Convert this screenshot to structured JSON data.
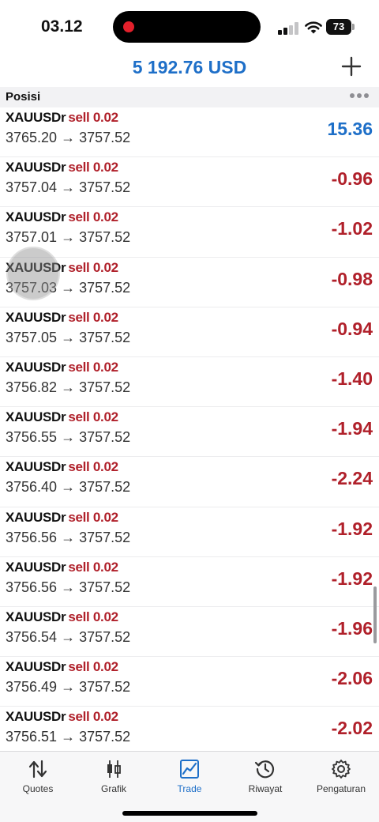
{
  "status": {
    "time": "03.12",
    "battery": "73"
  },
  "header": {
    "balance": "5 192.76 USD"
  },
  "section": {
    "title": "Posisi"
  },
  "positions": [
    {
      "symbol": "XAUUSDr",
      "side": "sell 0.02",
      "prices": "3765.20 → 3757.52",
      "profit": "15.36",
      "sign": "pos"
    },
    {
      "symbol": "XAUUSDr",
      "side": "sell 0.02",
      "prices": "3757.04 → 3757.52",
      "profit": "-0.96",
      "sign": "neg"
    },
    {
      "symbol": "XAUUSDr",
      "side": "sell 0.02",
      "prices": "3757.01 → 3757.52",
      "profit": "-1.02",
      "sign": "neg"
    },
    {
      "symbol": "XAUUSDr",
      "side": "sell 0.02",
      "prices": "3757.03 → 3757.52",
      "profit": "-0.98",
      "sign": "neg"
    },
    {
      "symbol": "XAUUSDr",
      "side": "sell 0.02",
      "prices": "3757.05 → 3757.52",
      "profit": "-0.94",
      "sign": "neg"
    },
    {
      "symbol": "XAUUSDr",
      "side": "sell 0.02",
      "prices": "3756.82 → 3757.52",
      "profit": "-1.40",
      "sign": "neg"
    },
    {
      "symbol": "XAUUSDr",
      "side": "sell 0.02",
      "prices": "3756.55 → 3757.52",
      "profit": "-1.94",
      "sign": "neg"
    },
    {
      "symbol": "XAUUSDr",
      "side": "sell 0.02",
      "prices": "3756.40 → 3757.52",
      "profit": "-2.24",
      "sign": "neg"
    },
    {
      "symbol": "XAUUSDr",
      "side": "sell 0.02",
      "prices": "3756.56 → 3757.52",
      "profit": "-1.92",
      "sign": "neg"
    },
    {
      "symbol": "XAUUSDr",
      "side": "sell 0.02",
      "prices": "3756.56 → 3757.52",
      "profit": "-1.92",
      "sign": "neg"
    },
    {
      "symbol": "XAUUSDr",
      "side": "sell 0.02",
      "prices": "3756.54 → 3757.52",
      "profit": "-1.96",
      "sign": "neg"
    },
    {
      "symbol": "XAUUSDr",
      "side": "sell 0.02",
      "prices": "3756.49 → 3757.52",
      "profit": "-2.06",
      "sign": "neg"
    },
    {
      "symbol": "XAUUSDr",
      "side": "sell 0.02",
      "prices": "3756.51 → 3757.52",
      "profit": "-2.02",
      "sign": "neg"
    }
  ],
  "tabs": [
    {
      "label": "Quotes",
      "icon": "quotes-icon"
    },
    {
      "label": "Grafik",
      "icon": "chart-icon"
    },
    {
      "label": "Trade",
      "icon": "trade-icon",
      "active": true
    },
    {
      "label": "Riwayat",
      "icon": "history-icon"
    },
    {
      "label": "Pengaturan",
      "icon": "gear-icon"
    }
  ],
  "colors": {
    "accent": "#1e6fc8",
    "loss": "#b0202a"
  }
}
